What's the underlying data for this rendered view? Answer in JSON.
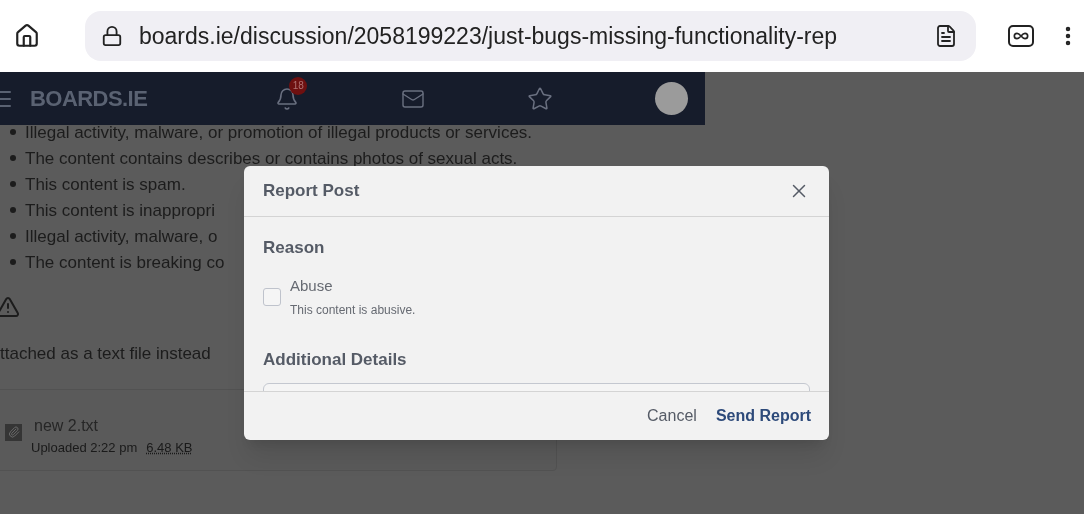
{
  "browser": {
    "url": "boards.ie/discussion/2058199223/just-bugs-missing-functionality-rep"
  },
  "nav": {
    "logo": "BOARDS.IE",
    "notification_count": "18"
  },
  "page": {
    "bullets": [
      "Illegal activity, malware, or promotion of illegal products or services.",
      "The content contains describes or contains photos of sexual acts.",
      "This content is spam.",
      "This content is inappropri",
      "Illegal activity, malware, o",
      "The content is breaking co"
    ],
    "attachment_note": "ttached as a text file instead",
    "attachment": {
      "name": "new 2.txt",
      "uploaded": "Uploaded 2:22 pm",
      "size": "6.48 KB"
    }
  },
  "dialog": {
    "title": "Report Post",
    "reason_heading": "Reason",
    "reasons": [
      {
        "label": "Abuse",
        "description": "This content is abusive.",
        "checked": false
      }
    ],
    "details_heading": "Additional Details",
    "buttons": [
      {
        "label": "Cancel",
        "kind": "secondary"
      },
      {
        "label": "Send Report",
        "kind": "primary"
      }
    ]
  }
}
